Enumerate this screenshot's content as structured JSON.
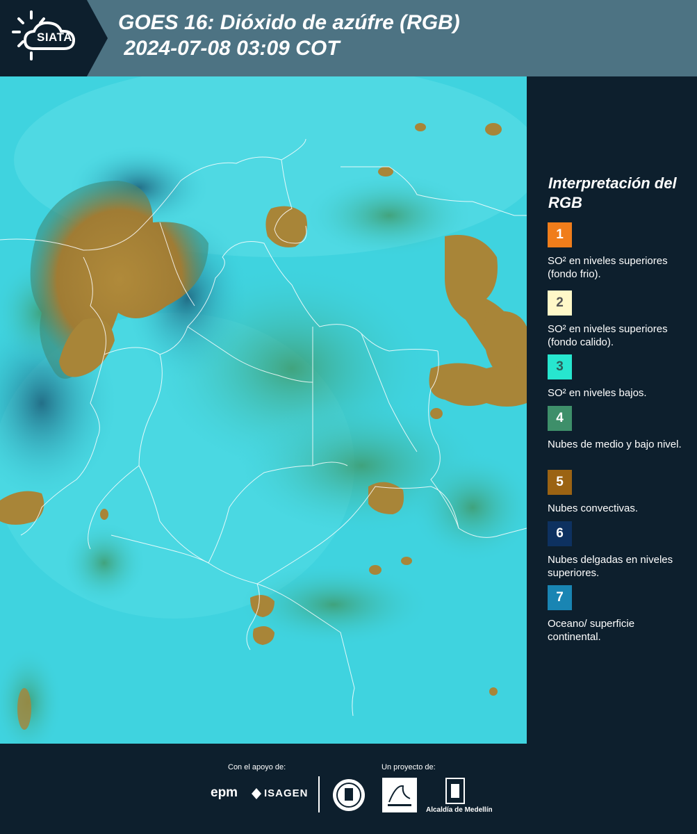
{
  "header": {
    "logo_text": "SIATA",
    "title": "GOES 16: Dióxido de azúfre (RGB)\n 2024-07-08 03:09 COT"
  },
  "map": {
    "background_color": "#3fd3df",
    "cloud_color": "#a9873b",
    "border_color": "#ffffff"
  },
  "legend": {
    "title": "Interpretación del RGB",
    "items": [
      {
        "number": "1",
        "color": "#f07d1b",
        "label": "SO² en niveles superiores (fondo frio)."
      },
      {
        "number": "2",
        "color": "#fff8c8",
        "label": "SO² en niveles superiores (fondo calido)."
      },
      {
        "number": "3",
        "color": "#27e6cf",
        "label": "SO² en niveles bajos."
      },
      {
        "number": "4",
        "color": "#3e8f6a",
        "label": "Nubes de medio y bajo nivel."
      },
      {
        "number": "5",
        "color": "#9b6313",
        "label": "Nubes convectivas."
      },
      {
        "number": "6",
        "color": "#0d3160",
        "label": "Nubes delgadas en niveles superiores."
      },
      {
        "number": "7",
        "color": "#1985b3",
        "label": "Oceano/ superficie continental."
      }
    ]
  },
  "footer": {
    "support_label": "Con el apoyo de:",
    "project_label": "Un proyecto de:",
    "epm": "epm",
    "isagen": "ISAGEN",
    "alcaldia": "Alcaldía de Medellín"
  }
}
